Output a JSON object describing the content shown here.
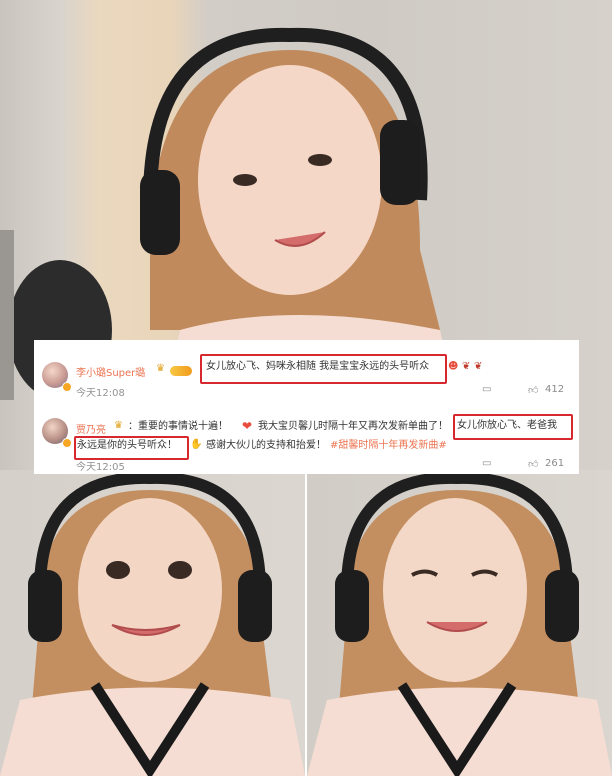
{
  "comments": [
    {
      "username": "李小璐Super璐",
      "text": "女儿放心飞、妈咪永相随 我是宝宝永远的头号听众",
      "time": "今天12:08",
      "likes": "412"
    },
    {
      "username": "贾乃亮",
      "text_a": "：重要的事情说十遍！",
      "text_b": "我大宝贝馨儿时隔十年又再次发新单曲了！",
      "text_c": "女儿你放心飞、老爸我",
      "text_d": "永远是你的头号听众！",
      "text_e": "感谢大伙儿的支持和抬爱！",
      "hashtag": "#甜馨时隔十年再发新曲#",
      "time": "今天12:05",
      "likes": "261"
    }
  ],
  "icons": {
    "reply": "comment-icon",
    "like": "thumbs-up-icon",
    "crown": "crown-icon",
    "heart": "heart-icon",
    "clap": "clap-icon"
  },
  "colors": {
    "username": "#eb7350",
    "highlight": "#d7282f",
    "hashtag": "#eb7350"
  }
}
